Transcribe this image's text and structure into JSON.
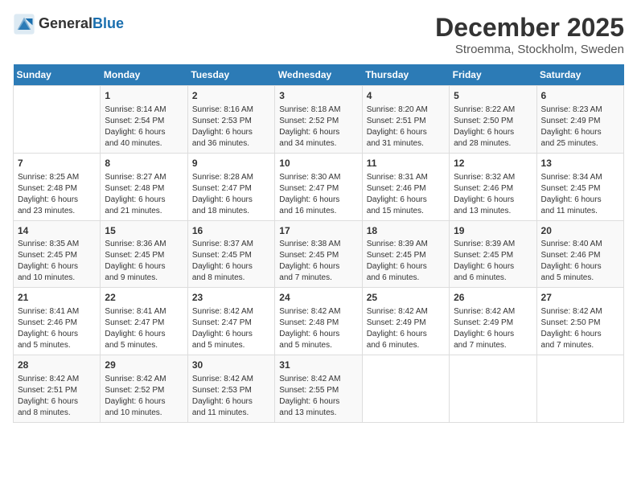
{
  "logo": {
    "general": "General",
    "blue": "Blue"
  },
  "title": "December 2025",
  "subtitle": "Stroemma, Stockholm, Sweden",
  "days_of_week": [
    "Sunday",
    "Monday",
    "Tuesday",
    "Wednesday",
    "Thursday",
    "Friday",
    "Saturday"
  ],
  "weeks": [
    [
      {
        "day": "",
        "content": ""
      },
      {
        "day": "1",
        "content": "Sunrise: 8:14 AM\nSunset: 2:54 PM\nDaylight: 6 hours\nand 40 minutes."
      },
      {
        "day": "2",
        "content": "Sunrise: 8:16 AM\nSunset: 2:53 PM\nDaylight: 6 hours\nand 36 minutes."
      },
      {
        "day": "3",
        "content": "Sunrise: 8:18 AM\nSunset: 2:52 PM\nDaylight: 6 hours\nand 34 minutes."
      },
      {
        "day": "4",
        "content": "Sunrise: 8:20 AM\nSunset: 2:51 PM\nDaylight: 6 hours\nand 31 minutes."
      },
      {
        "day": "5",
        "content": "Sunrise: 8:22 AM\nSunset: 2:50 PM\nDaylight: 6 hours\nand 28 minutes."
      },
      {
        "day": "6",
        "content": "Sunrise: 8:23 AM\nSunset: 2:49 PM\nDaylight: 6 hours\nand 25 minutes."
      }
    ],
    [
      {
        "day": "7",
        "content": "Sunrise: 8:25 AM\nSunset: 2:48 PM\nDaylight: 6 hours\nand 23 minutes."
      },
      {
        "day": "8",
        "content": "Sunrise: 8:27 AM\nSunset: 2:48 PM\nDaylight: 6 hours\nand 21 minutes."
      },
      {
        "day": "9",
        "content": "Sunrise: 8:28 AM\nSunset: 2:47 PM\nDaylight: 6 hours\nand 18 minutes."
      },
      {
        "day": "10",
        "content": "Sunrise: 8:30 AM\nSunset: 2:47 PM\nDaylight: 6 hours\nand 16 minutes."
      },
      {
        "day": "11",
        "content": "Sunrise: 8:31 AM\nSunset: 2:46 PM\nDaylight: 6 hours\nand 15 minutes."
      },
      {
        "day": "12",
        "content": "Sunrise: 8:32 AM\nSunset: 2:46 PM\nDaylight: 6 hours\nand 13 minutes."
      },
      {
        "day": "13",
        "content": "Sunrise: 8:34 AM\nSunset: 2:45 PM\nDaylight: 6 hours\nand 11 minutes."
      }
    ],
    [
      {
        "day": "14",
        "content": "Sunrise: 8:35 AM\nSunset: 2:45 PM\nDaylight: 6 hours\nand 10 minutes."
      },
      {
        "day": "15",
        "content": "Sunrise: 8:36 AM\nSunset: 2:45 PM\nDaylight: 6 hours\nand 9 minutes."
      },
      {
        "day": "16",
        "content": "Sunrise: 8:37 AM\nSunset: 2:45 PM\nDaylight: 6 hours\nand 8 minutes."
      },
      {
        "day": "17",
        "content": "Sunrise: 8:38 AM\nSunset: 2:45 PM\nDaylight: 6 hours\nand 7 minutes."
      },
      {
        "day": "18",
        "content": "Sunrise: 8:39 AM\nSunset: 2:45 PM\nDaylight: 6 hours\nand 6 minutes."
      },
      {
        "day": "19",
        "content": "Sunrise: 8:39 AM\nSunset: 2:45 PM\nDaylight: 6 hours\nand 6 minutes."
      },
      {
        "day": "20",
        "content": "Sunrise: 8:40 AM\nSunset: 2:46 PM\nDaylight: 6 hours\nand 5 minutes."
      }
    ],
    [
      {
        "day": "21",
        "content": "Sunrise: 8:41 AM\nSunset: 2:46 PM\nDaylight: 6 hours\nand 5 minutes."
      },
      {
        "day": "22",
        "content": "Sunrise: 8:41 AM\nSunset: 2:47 PM\nDaylight: 6 hours\nand 5 minutes."
      },
      {
        "day": "23",
        "content": "Sunrise: 8:42 AM\nSunset: 2:47 PM\nDaylight: 6 hours\nand 5 minutes."
      },
      {
        "day": "24",
        "content": "Sunrise: 8:42 AM\nSunset: 2:48 PM\nDaylight: 6 hours\nand 5 minutes."
      },
      {
        "day": "25",
        "content": "Sunrise: 8:42 AM\nSunset: 2:49 PM\nDaylight: 6 hours\nand 6 minutes."
      },
      {
        "day": "26",
        "content": "Sunrise: 8:42 AM\nSunset: 2:49 PM\nDaylight: 6 hours\nand 7 minutes."
      },
      {
        "day": "27",
        "content": "Sunrise: 8:42 AM\nSunset: 2:50 PM\nDaylight: 6 hours\nand 7 minutes."
      }
    ],
    [
      {
        "day": "28",
        "content": "Sunrise: 8:42 AM\nSunset: 2:51 PM\nDaylight: 6 hours\nand 8 minutes."
      },
      {
        "day": "29",
        "content": "Sunrise: 8:42 AM\nSunset: 2:52 PM\nDaylight: 6 hours\nand 10 minutes."
      },
      {
        "day": "30",
        "content": "Sunrise: 8:42 AM\nSunset: 2:53 PM\nDaylight: 6 hours\nand 11 minutes."
      },
      {
        "day": "31",
        "content": "Sunrise: 8:42 AM\nSunset: 2:55 PM\nDaylight: 6 hours\nand 13 minutes."
      },
      {
        "day": "",
        "content": ""
      },
      {
        "day": "",
        "content": ""
      },
      {
        "day": "",
        "content": ""
      }
    ]
  ]
}
